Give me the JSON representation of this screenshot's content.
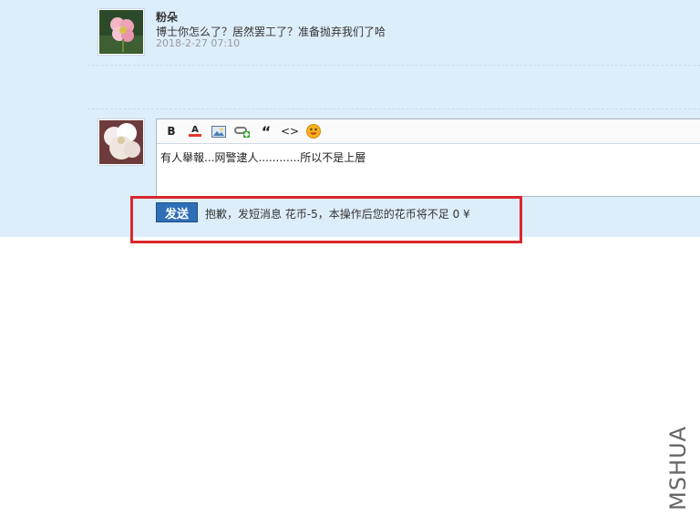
{
  "message": {
    "sender": "粉朵",
    "text": "博士你怎么了？居然罢工了？准备抛弃我们了哈",
    "time": "2018-2-27 07:10"
  },
  "editor": {
    "toolbar": {
      "bold": "B",
      "font_color": "A",
      "quote": "“",
      "code": "<>"
    },
    "content": "有人舉報...网警逮人............所以不是上層"
  },
  "send": {
    "button_label": "发送",
    "notice": "抱歉，发短消息 花币-5，本操作后您的花币将不足 0 ¥"
  },
  "watermark": "MSHUA",
  "colors": {
    "panel_bg": "#ddeefb",
    "send_button": "#2f6fb7",
    "highlight_border": "#d9272e"
  }
}
